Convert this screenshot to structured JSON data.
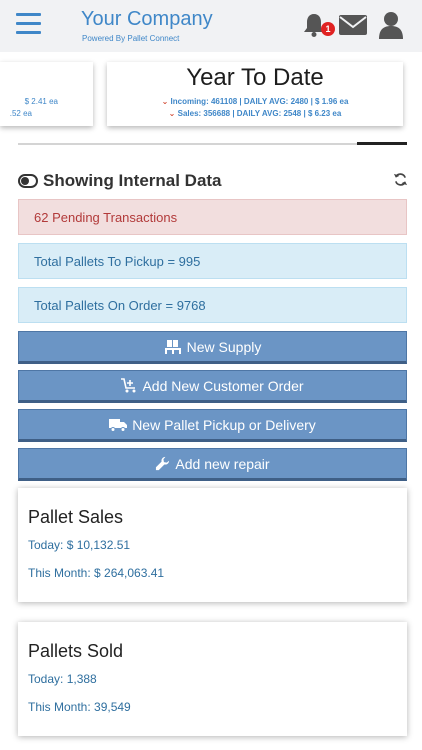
{
  "header": {
    "brand_title": "Your Company",
    "brand_subtitle": "Powered By Pallet Connect",
    "notification_count": "1",
    "icons": [
      "menu-icon",
      "bell-icon",
      "mail-icon",
      "user-icon"
    ],
    "accent_color": "#3f87c8"
  },
  "carousel": {
    "prev_card": {
      "line1": "$ 2.41 ea",
      "line2": ".52 ea"
    },
    "current_card": {
      "title": "Year To Date",
      "incoming": "Incoming: 461108 | DAILY AVG: 2480 | $ 1.96 ea",
      "sales": "Sales: 356688 | DAILY AVG: 2548 | $ 6.23 ea"
    }
  },
  "section": {
    "heading": "Showing Internal Data"
  },
  "alerts": {
    "pending": "62 Pending Transactions",
    "pickup": "Total Pallets To Pickup = 995",
    "order": "Total Pallets On Order = 9768"
  },
  "buttons": {
    "new_supply": "New Supply",
    "new_customer_order": "Add New Customer Order",
    "new_pickup_delivery": "New Pallet Pickup or Delivery",
    "new_repair": "Add new repair"
  },
  "metrics": {
    "pallet_sales": {
      "title": "Pallet Sales",
      "today": "Today: $ 10,132.51",
      "month": "This Month: $ 264,063.41"
    },
    "pallets_sold": {
      "title": "Pallets Sold",
      "today": "Today: 1,388",
      "month": "This Month: 39,549"
    }
  }
}
